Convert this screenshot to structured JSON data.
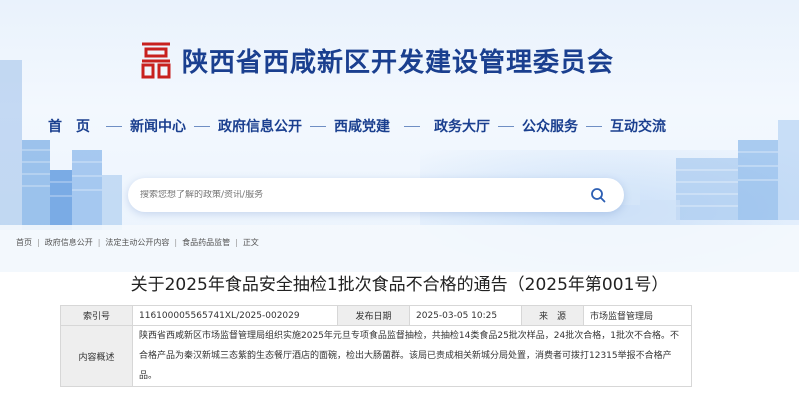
{
  "site": {
    "title": "陕西省西咸新区开发建设管理委员会"
  },
  "nav": [
    {
      "label": "首　页"
    },
    {
      "label": "新闻中心"
    },
    {
      "label": "政府信息公开"
    },
    {
      "label": "西咸党建"
    },
    {
      "label": "政务大厅"
    },
    {
      "label": "公众服务"
    },
    {
      "label": "互动交流"
    }
  ],
  "search": {
    "placeholder": "搜索您想了解的政策/资讯/服务"
  },
  "breadcrumb": [
    "首页",
    "政府信息公开",
    "法定主动公开内容",
    "食品药品监管",
    "正文"
  ],
  "article": {
    "title": "关于2025年食品安全抽检1批次食品不合格的通告（2025年第001号）",
    "index_label": "索引号",
    "index_value": "116100005565741XL/2025-002029",
    "date_label": "发布日期",
    "date_value": "2025-03-05 10:25",
    "source_label": "来　源",
    "source_value": "市场监督管理局",
    "summary_label": "内容概述",
    "summary_value": "陕西省西咸新区市场监督管理局组织实施2025年元旦专项食品监督抽检，共抽检14类食品25批次样品，24批次合格，1批次不合格。不合格产品为秦汉新城三态紫韵生态餐厅酒店的面碗，检出大肠菌群。该局已责成相关新城分局处置，消费者可拨打12315举报不合格产品。"
  },
  "colors": {
    "brand": "#1a3f8f",
    "logo_red": "#c8201e"
  }
}
